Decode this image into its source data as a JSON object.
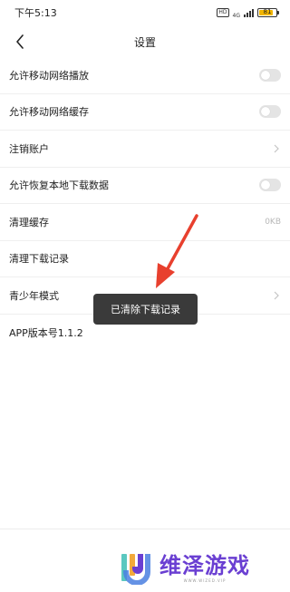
{
  "status_bar": {
    "time": "下午5:13",
    "hd": "HD",
    "network": "4G",
    "battery_level": "81",
    "battery_fraction": 0.81,
    "colors": {
      "battery": "#f0b400"
    }
  },
  "header": {
    "title": "设置",
    "back_icon": "chevron-left-icon"
  },
  "settings": {
    "allow_mobile_play": {
      "label": "允许移动网络播放",
      "enabled": false
    },
    "allow_mobile_cache": {
      "label": "允许移动网络缓存",
      "enabled": false
    },
    "cancel_account": {
      "label": "注销账户"
    },
    "allow_restore_local": {
      "label": "允许恢复本地下载数据",
      "enabled": false
    },
    "clear_cache": {
      "label": "清理缓存",
      "value": "0KB"
    },
    "clear_download_records": {
      "label": "清理下载记录"
    },
    "youth_mode": {
      "label": "青少年模式"
    },
    "app_version": {
      "label": "APP版本号1.1.2"
    }
  },
  "toast": {
    "text": "已清除下载记录"
  },
  "annotation": {
    "color": "#e8402e"
  },
  "watermark": {
    "title": "维泽游戏",
    "subtitle": "WWW.WIZED.VIP",
    "colors": {
      "primary": "#6a3fd2",
      "logo_left": "#5bc8c0",
      "logo_mid": "#f2a93b"
    }
  }
}
